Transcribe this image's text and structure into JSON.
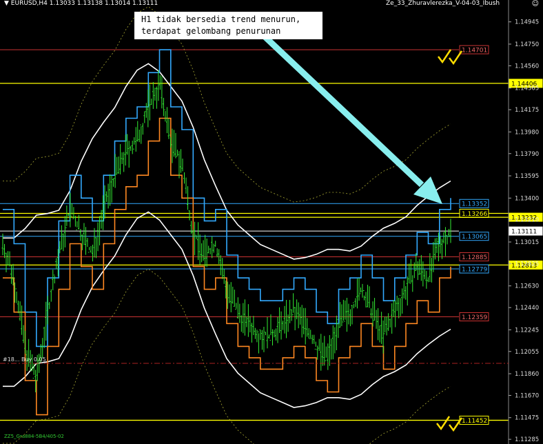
{
  "header": {
    "symbol": "EURUSD,H4",
    "ohlc": "1.13033 1.13138 1.13014 1.13111",
    "indicator": "Ze_33_Zhuravlerezka_V-04-03_Ibush"
  },
  "callout": {
    "line1": "H1 tidak bersedia trend menurun,",
    "line2": "terdapat gelombang penurunan"
  },
  "footer_label": "ZZ5_Gra884-5B4/405-02",
  "order_label": "#18... Buy 0.05",
  "colors": {
    "background": "#000000",
    "candles": "#33ee33",
    "bands": "#ffffff",
    "blue_channel": "#33aaff",
    "orange_channel": "#ff8822",
    "yellow_level": "#ffff00",
    "red_level": "#cc3333",
    "arrow": "#88eeee",
    "checkmark": "#ffdd00"
  },
  "chart_data": {
    "type": "candlestick",
    "symbol": "EURUSD",
    "timeframe": "H4",
    "price_axis_ticks": [
      1.14945,
      1.1475,
      1.1456,
      1.14365,
      1.14175,
      1.1398,
      1.1379,
      1.13595,
      1.134,
      1.1321,
      1.13015,
      1.12825,
      1.1263,
      1.1244,
      1.12245,
      1.12055,
      1.1186,
      1.1167,
      1.11475,
      1.11285
    ],
    "ylim": [
      1.1128,
      1.1504
    ],
    "price_levels": [
      {
        "value": 1.14701,
        "color": "#cc3333"
      },
      {
        "value": 1.14406,
        "color": "#ffff00"
      },
      {
        "value": 1.13352,
        "color": "#33aaff"
      },
      {
        "value": 1.13266,
        "color": "#ffff00"
      },
      {
        "value": 1.13232,
        "color": "#ffff00"
      },
      {
        "value": 1.13111,
        "color": "#ffffff"
      },
      {
        "value": 1.13065,
        "color": "#33aaff"
      },
      {
        "value": 1.12885,
        "color": "#cc3333"
      },
      {
        "value": 1.12813,
        "color": "#ffff00"
      },
      {
        "value": 1.12779,
        "color": "#33aaff"
      },
      {
        "value": 1.12359,
        "color": "#cc3333"
      },
      {
        "value": 1.11452,
        "color": "#ffff00"
      }
    ],
    "close_path": [
      1.13,
      1.127,
      1.121,
      1.118,
      1.124,
      1.129,
      1.133,
      1.131,
      1.129,
      1.133,
      1.136,
      1.138,
      1.139,
      1.142,
      1.144,
      1.139,
      1.137,
      1.131,
      1.129,
      1.13,
      1.126,
      1.124,
      1.123,
      1.122,
      1.122,
      1.123,
      1.124,
      1.123,
      1.121,
      1.12,
      1.123,
      1.124,
      1.126,
      1.124,
      1.122,
      1.124,
      1.126,
      1.128,
      1.127,
      1.13,
      1.131
    ]
  }
}
